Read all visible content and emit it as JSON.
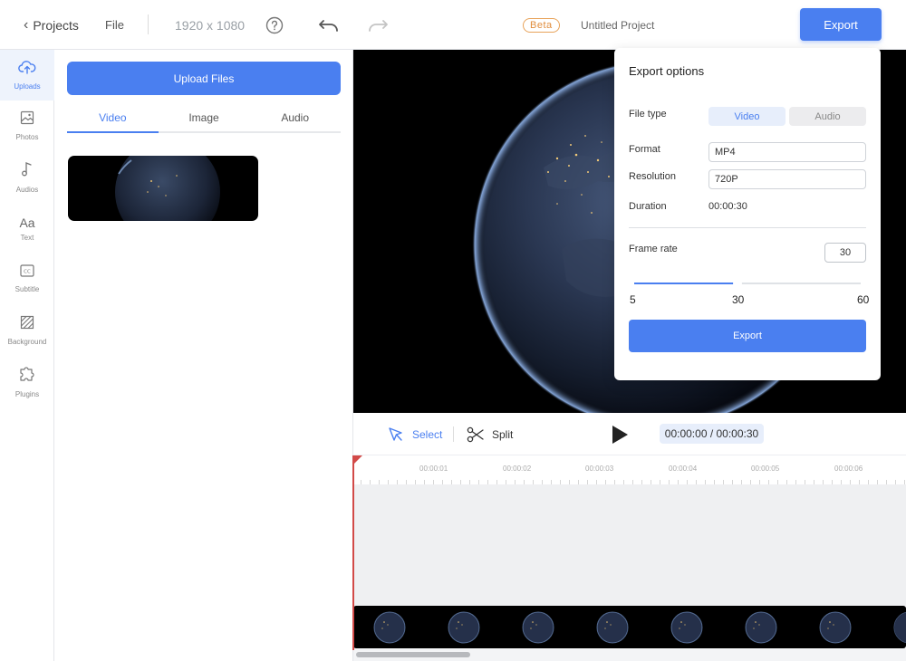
{
  "topbar": {
    "projects_label": "Projects",
    "file_label": "File",
    "resolution": "1920 x 1080",
    "beta_badge": "Beta",
    "project_name": "Untitled Project",
    "export_label": "Export",
    "icons": [
      "chevron-left-icon",
      "help-icon",
      "undo-icon",
      "redo-icon"
    ]
  },
  "sidebar": {
    "items": [
      {
        "label": "Uploads",
        "icon": "cloud-upload-icon",
        "active": true
      },
      {
        "label": "Photos",
        "icon": "image-icon",
        "active": false
      },
      {
        "label": "Audios",
        "icon": "music-note-icon",
        "active": false
      },
      {
        "label": "Text",
        "icon": "text-icon",
        "active": false
      },
      {
        "label": "Subtitle",
        "icon": "closed-caption-icon",
        "active": false
      },
      {
        "label": "Background",
        "icon": "hatch-pattern-icon",
        "active": false
      },
      {
        "label": "Plugins",
        "icon": "puzzle-icon",
        "active": false
      }
    ]
  },
  "media_panel": {
    "upload_label": "Upload Files",
    "tabs": [
      {
        "label": "Video",
        "active": true
      },
      {
        "label": "Image",
        "active": false
      },
      {
        "label": "Audio",
        "active": false
      }
    ]
  },
  "controls": {
    "select_label": "Select",
    "split_label": "Split",
    "timecode": "00:00:00 / 00:00:30"
  },
  "timeline": {
    "ticks": [
      "00:00:01",
      "00:00:02",
      "00:00:03",
      "00:00:04",
      "00:00:05",
      "00:00:06"
    ]
  },
  "export_popup": {
    "title": "Export options",
    "file_type_label": "File type",
    "file_type_options": [
      "Video",
      "Audio"
    ],
    "file_type_selected": "Video",
    "format_label": "Format",
    "format_value": "MP4",
    "resolution_label": "Resolution",
    "resolution_value": "720P",
    "duration_label": "Duration",
    "duration_value": "00:00:30",
    "frame_rate_label": "Frame rate",
    "frame_rate_value": "30",
    "slider_min": "5",
    "slider_mid": "30",
    "slider_max": "60",
    "slider_value": 30,
    "export_label": "Export"
  },
  "colors": {
    "accent": "#4a7ff0",
    "beta": "#e08c3b",
    "playhead": "#d24a48"
  }
}
